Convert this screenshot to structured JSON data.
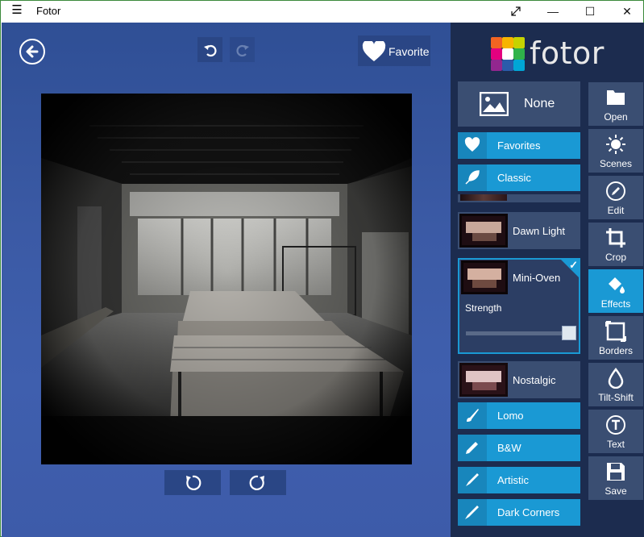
{
  "window": {
    "title": "Fotor",
    "menu_glyph": "☰",
    "minimize_glyph": "—",
    "maximize_glyph": "☐",
    "close_glyph": "✕",
    "restore_icon": "expand-arrows-icon"
  },
  "toolbar": {
    "back_icon": "arrow-left-circle-icon",
    "undo_icon": "undo-icon",
    "redo_icon": "redo-icon",
    "favorite_label": "Favorite",
    "favorite_icon": "heart-icon",
    "rotate_left_icon": "rotate-left-icon",
    "rotate_right_icon": "rotate-right-icon"
  },
  "brand": {
    "logo_text": "fotor"
  },
  "effects_panel": {
    "none_label": "None",
    "categories_top": [
      {
        "label": "Favorites",
        "icon": "heart-icon"
      },
      {
        "label": "Classic",
        "icon": "feather-icon"
      }
    ],
    "effects": [
      {
        "label": "Dawn Light"
      },
      {
        "label": "Nostalgic"
      }
    ],
    "selected_effect": {
      "label": "Mini-Oven",
      "strength_label": "Strength",
      "strength_value": 1.0
    },
    "categories_bottom": [
      {
        "label": "Lomo",
        "icon": "brush-icon"
      },
      {
        "label": "B&W",
        "icon": "pencil-icon"
      },
      {
        "label": "Artistic",
        "icon": "paintbrush-icon"
      },
      {
        "label": "Dark Corners",
        "icon": "pen-icon"
      }
    ]
  },
  "side_nav": [
    {
      "label": "Open",
      "icon": "folder-icon"
    },
    {
      "label": "Scenes",
      "icon": "sun-icon"
    },
    {
      "label": "Edit",
      "icon": "edit-pencil-icon"
    },
    {
      "label": "Crop",
      "icon": "crop-icon"
    },
    {
      "label": "Effects",
      "icon": "paint-bucket-icon",
      "active": true
    },
    {
      "label": "Borders",
      "icon": "border-frame-icon"
    },
    {
      "label": "Tilt-Shift",
      "icon": "droplet-icon"
    },
    {
      "label": "Text",
      "icon": "text-circle-icon"
    },
    {
      "label": "Save",
      "icon": "floppy-disk-icon"
    }
  ],
  "colors": {
    "accent": "#1a99d4",
    "panel_bg": "#1c2c4f",
    "tile_bg": "#3a4e72",
    "workspace_bg": "#3b5aa5"
  }
}
